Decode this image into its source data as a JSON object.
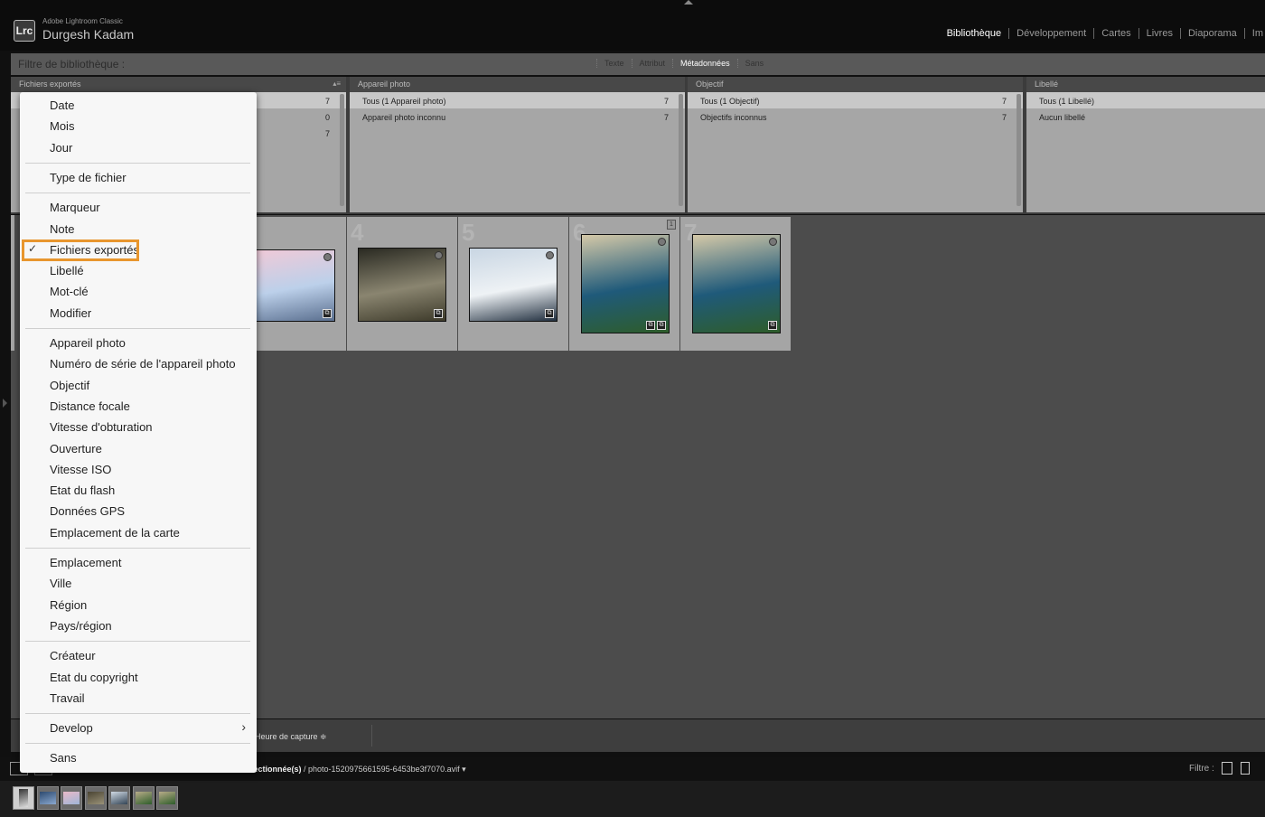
{
  "identity": {
    "logo": "Lrc",
    "app_name": "Adobe Lightroom Classic",
    "user_name": "Durgesh Kadam"
  },
  "modules": [
    {
      "label": "Bibliothèque",
      "active": true
    },
    {
      "label": "Développement",
      "active": false
    },
    {
      "label": "Cartes",
      "active": false
    },
    {
      "label": "Livres",
      "active": false
    },
    {
      "label": "Diaporama",
      "active": false
    },
    {
      "label": "Im",
      "active": false
    }
  ],
  "filter_bar": {
    "title": "Filtre de bibliothèque :",
    "modes": [
      {
        "label": "Texte",
        "active": false
      },
      {
        "label": "Attribut",
        "active": false
      },
      {
        "label": "Métadonnées",
        "active": true
      },
      {
        "label": "Sans",
        "active": false
      }
    ]
  },
  "metadata_columns": [
    {
      "header": "Fichiers exportés",
      "rows": [
        {
          "label": "",
          "count": "7",
          "selected": true
        },
        {
          "label": "",
          "count": "0",
          "selected": false
        },
        {
          "label": "",
          "count": "7",
          "selected": false
        }
      ]
    },
    {
      "header": "Appareil photo",
      "rows": [
        {
          "label": "Tous (1 Appareil photo)",
          "count": "7",
          "selected": true
        },
        {
          "label": "Appareil photo inconnu",
          "count": "7",
          "selected": false
        }
      ]
    },
    {
      "header": "Objectif",
      "rows": [
        {
          "label": "Tous (1 Objectif)",
          "count": "7",
          "selected": true
        },
        {
          "label": "Objectifs inconnus",
          "count": "7",
          "selected": false
        }
      ]
    },
    {
      "header": "Libellé",
      "rows": [
        {
          "label": "Tous (1 Libellé)",
          "count": "",
          "selected": true
        },
        {
          "label": "Aucun libellé",
          "count": "",
          "selected": false
        }
      ]
    }
  ],
  "grid_cells": [
    {
      "index": "",
      "subject": "snowy mountains",
      "colors": [
        "#f3c9d6",
        "#bcd0ea",
        "#5a6f8f"
      ],
      "badge": ""
    },
    {
      "index": "4",
      "subject": "arctic fox",
      "colors": [
        "#2a2a22",
        "#8a8570",
        "#3d3a2a"
      ],
      "badge": ""
    },
    {
      "index": "5",
      "subject": "ice cliffs",
      "colors": [
        "#c9d6e3",
        "#eef2f5",
        "#223040"
      ],
      "badge": ""
    },
    {
      "index": "6",
      "subject": "peacock",
      "colors": [
        "#d5c9a8",
        "#1f5a7a",
        "#2e5d2a"
      ],
      "badge": "1"
    },
    {
      "index": "7",
      "subject": "peacock",
      "colors": [
        "#d5c9a8",
        "#1f5a7a",
        "#2e5d2a"
      ],
      "badge": ""
    }
  ],
  "toolbar": {
    "sort_label": "Heure de capture ≑"
  },
  "filmstrip": {
    "path_prefix": "",
    "path_bold": "sélectionnée(s)",
    "path_rest": " / photo-1520975661595-6453be3f7070.avif ▾",
    "filter_label": "Filtre :",
    "thumbs": [
      {
        "colors": [
          "#333",
          "#ddd"
        ],
        "selected": true
      },
      {
        "colors": [
          "#2d4a6f",
          "#8aa8cf"
        ],
        "selected": false
      },
      {
        "colors": [
          "#e9b9c8",
          "#9fb6d8"
        ],
        "selected": false
      },
      {
        "colors": [
          "#4a4433",
          "#9a9278"
        ],
        "selected": false
      },
      {
        "colors": [
          "#cfd9e3",
          "#334455"
        ],
        "selected": false
      },
      {
        "colors": [
          "#b7ab88",
          "#2e5d2a"
        ],
        "selected": false
      },
      {
        "colors": [
          "#b7ab88",
          "#2e5d2a"
        ],
        "selected": false
      }
    ]
  },
  "menu": {
    "groups": [
      [
        {
          "label": "Date",
          "checked": false,
          "submenu": false
        },
        {
          "label": "Mois",
          "checked": false,
          "submenu": false
        },
        {
          "label": "Jour",
          "checked": false,
          "submenu": false
        }
      ],
      [
        {
          "label": "Type de fichier",
          "checked": false,
          "submenu": false
        }
      ],
      [
        {
          "label": "Marqueur",
          "checked": false,
          "submenu": false
        },
        {
          "label": "Note",
          "checked": false,
          "submenu": false
        },
        {
          "label": "Fichiers exportés",
          "checked": true,
          "submenu": false
        },
        {
          "label": "Libellé",
          "checked": false,
          "submenu": false
        },
        {
          "label": "Mot-clé",
          "checked": false,
          "submenu": false
        },
        {
          "label": "Modifier",
          "checked": false,
          "submenu": false
        }
      ],
      [
        {
          "label": "Appareil photo",
          "checked": false,
          "submenu": false
        },
        {
          "label": "Numéro de série de l'appareil photo",
          "checked": false,
          "submenu": false
        },
        {
          "label": "Objectif",
          "checked": false,
          "submenu": false
        },
        {
          "label": "Distance focale",
          "checked": false,
          "submenu": false
        },
        {
          "label": "Vitesse d'obturation",
          "checked": false,
          "submenu": false
        },
        {
          "label": "Ouverture",
          "checked": false,
          "submenu": false
        },
        {
          "label": "Vitesse ISO",
          "checked": false,
          "submenu": false
        },
        {
          "label": "Etat du flash",
          "checked": false,
          "submenu": false
        },
        {
          "label": "Données GPS",
          "checked": false,
          "submenu": false
        },
        {
          "label": "Emplacement de la carte",
          "checked": false,
          "submenu": false
        }
      ],
      [
        {
          "label": "Emplacement",
          "checked": false,
          "submenu": false
        },
        {
          "label": "Ville",
          "checked": false,
          "submenu": false
        },
        {
          "label": "Région",
          "checked": false,
          "submenu": false
        },
        {
          "label": "Pays/région",
          "checked": false,
          "submenu": false
        }
      ],
      [
        {
          "label": "Créateur",
          "checked": false,
          "submenu": false
        },
        {
          "label": "Etat du copyright",
          "checked": false,
          "submenu": false
        },
        {
          "label": "Travail",
          "checked": false,
          "submenu": false
        }
      ],
      [
        {
          "label": "Develop",
          "checked": false,
          "submenu": true
        }
      ],
      [
        {
          "label": "Sans",
          "checked": false,
          "submenu": false
        }
      ]
    ],
    "highlight_color": "#e8962e"
  }
}
